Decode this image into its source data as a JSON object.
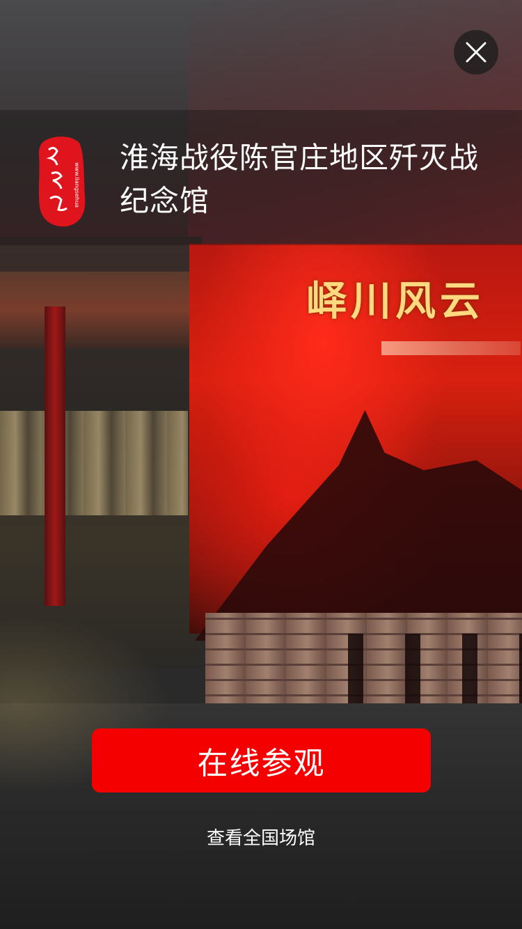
{
  "background": {
    "scene_sign_text": "峄川风云"
  },
  "close": {
    "icon": "close-icon"
  },
  "header": {
    "logo": {
      "icon": "red-seal-logo",
      "vertical_text": "www.liangsehua"
    },
    "title": "淮海战役陈官庄地区歼灭战纪念馆"
  },
  "actions": {
    "primary_label": "在线参观",
    "secondary_label": "查看全国场馆"
  },
  "colors": {
    "primary_button": "#f40000",
    "seal_red": "#e0141c",
    "text": "#ffffff"
  }
}
